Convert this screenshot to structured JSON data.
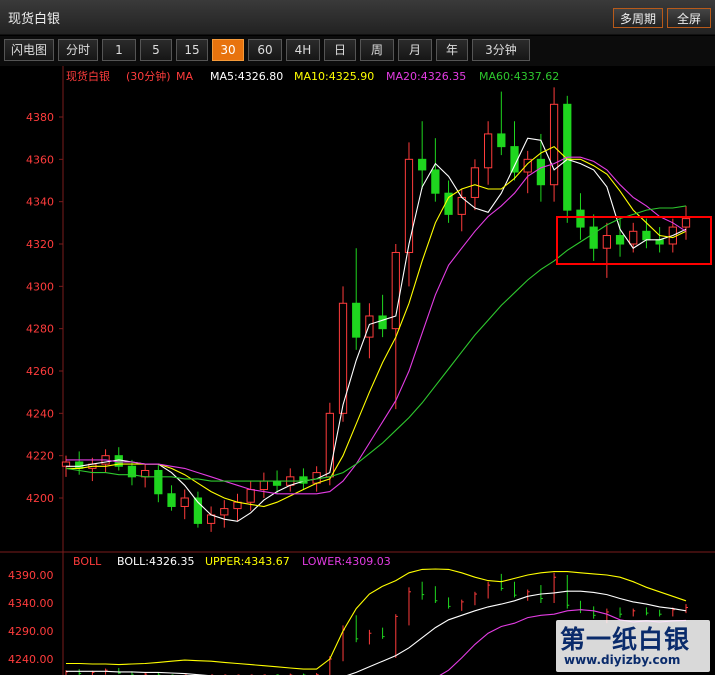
{
  "window": {
    "title": "现货白银",
    "buttons": [
      "多周期",
      "全屏"
    ]
  },
  "toolbar": {
    "periods": [
      "闪电图",
      "分时",
      "1",
      "5",
      "15",
      "30",
      "60",
      "4H",
      "日",
      "周",
      "月",
      "年",
      "3分钟"
    ],
    "active": "30"
  },
  "legend_main": {
    "symbol": "现货白银",
    "period": "(30分钟)",
    "indicator": "MA",
    "ma5": "MA5:4326.80",
    "ma10": "MA10:4325.90",
    "ma20": "MA20:4326.35",
    "ma60": "MA60:4337.62"
  },
  "legend_sub": {
    "indicator": "BOLL",
    "boll": "BOLL:4326.35",
    "upper": "UPPER:4343.67",
    "lower": "LOWER:4309.03"
  },
  "watermark": {
    "text": "第一纸白银",
    "url": "www.diyizby.com"
  },
  "colors": {
    "up": "#ff3c3c",
    "down": "#1fd61f",
    "ma5": "#ffffff",
    "ma10": "#ffff00",
    "ma20": "#e33ce3",
    "ma60": "#2ec82e",
    "axis_label_main": "#ff3c3c",
    "highlight_box": "#ff0000"
  },
  "chart_data": [
    {
      "type": "candlestick",
      "title": "现货白银 (30分钟) MA",
      "ylim": [
        4180,
        4400
      ],
      "y_ticks": [
        4200,
        4220,
        4240,
        4260,
        4280,
        4300,
        4320,
        4340,
        4360,
        4380
      ],
      "grid": false,
      "series": [
        {
          "name": "MA5",
          "values": [
            4215,
            4215,
            4216,
            4217,
            4218,
            4217,
            4216,
            4216,
            4212,
            4206,
            4198,
            4192,
            4190,
            4189,
            4193,
            4199,
            4203,
            4206,
            4208,
            4209,
            4212,
            4244,
            4265,
            4282,
            4284,
            4286,
            4320,
            4347,
            4358,
            4352,
            4342,
            4337,
            4335,
            4344,
            4357,
            4370,
            4369,
            4355,
            4360,
            4358,
            4355,
            4347,
            4327,
            4318,
            4322,
            4322,
            4324,
            4327
          ]
        },
        {
          "name": "MA10",
          "values": [
            4214,
            4214,
            4215,
            4215,
            4216,
            4216,
            4216,
            4216,
            4214,
            4211,
            4207,
            4203,
            4200,
            4198,
            4197,
            4196,
            4198,
            4201,
            4204,
            4207,
            4209,
            4220,
            4235,
            4250,
            4264,
            4276,
            4292,
            4312,
            4330,
            4342,
            4346,
            4348,
            4346,
            4346,
            4351,
            4358,
            4363,
            4366,
            4360,
            4360,
            4357,
            4353,
            4345,
            4336,
            4330,
            4324,
            4323,
            4326
          ]
        },
        {
          "name": "MA20",
          "values": [
            4218,
            4218,
            4218,
            4218,
            4217,
            4217,
            4216,
            4216,
            4215,
            4214,
            4212,
            4210,
            4208,
            4206,
            4204,
            4203,
            4202,
            4202,
            4202,
            4202,
            4203,
            4208,
            4216,
            4226,
            4236,
            4246,
            4260,
            4278,
            4296,
            4310,
            4318,
            4326,
            4333,
            4338,
            4344,
            4352,
            4356,
            4358,
            4361,
            4361,
            4359,
            4355,
            4348,
            4342,
            4338,
            4333,
            4330,
            4326
          ]
        },
        {
          "name": "MA60",
          "values": [
            4214,
            4213,
            4212,
            4212,
            4211,
            4211,
            4210,
            4210,
            4210,
            4209,
            4209,
            4208,
            4208,
            4208,
            4208,
            4208,
            4208,
            4208,
            4208,
            4209,
            4210,
            4212,
            4216,
            4221,
            4226,
            4232,
            4238,
            4245,
            4253,
            4261,
            4269,
            4277,
            4284,
            4291,
            4297,
            4303,
            4308,
            4312,
            4317,
            4321,
            4325,
            4329,
            4332,
            4334,
            4336,
            4337,
            4337,
            4338
          ]
        }
      ],
      "ohlc": [
        [
          4215,
          4220,
          4210,
          4217
        ],
        [
          4217,
          4222,
          4211,
          4214
        ],
        [
          4214,
          4219,
          4208,
          4216
        ],
        [
          4216,
          4223,
          4212,
          4220
        ],
        [
          4220,
          4224,
          4213,
          4215
        ],
        [
          4215,
          4218,
          4206,
          4210
        ],
        [
          4210,
          4216,
          4205,
          4213
        ],
        [
          4213,
          4216,
          4198,
          4202
        ],
        [
          4202,
          4206,
          4194,
          4196
        ],
        [
          4196,
          4204,
          4190,
          4200
        ],
        [
          4200,
          4203,
          4186,
          4188
        ],
        [
          4188,
          4196,
          4184,
          4192
        ],
        [
          4192,
          4199,
          4186,
          4195
        ],
        [
          4195,
          4202,
          4189,
          4198
        ],
        [
          4198,
          4208,
          4194,
          4204
        ],
        [
          4204,
          4212,
          4200,
          4208
        ],
        [
          4208,
          4213,
          4202,
          4206
        ],
        [
          4206,
          4214,
          4203,
          4210
        ],
        [
          4210,
          4214,
          4204,
          4207
        ],
        [
          4207,
          4215,
          4203,
          4212
        ],
        [
          4210,
          4245,
          4206,
          4240
        ],
        [
          4240,
          4300,
          4236,
          4292
        ],
        [
          4292,
          4318,
          4270,
          4276
        ],
        [
          4276,
          4292,
          4266,
          4286
        ],
        [
          4286,
          4296,
          4276,
          4280
        ],
        [
          4280,
          4320,
          4242,
          4316
        ],
        [
          4316,
          4368,
          4300,
          4360
        ],
        [
          4360,
          4378,
          4346,
          4355
        ],
        [
          4355,
          4370,
          4340,
          4344
        ],
        [
          4344,
          4350,
          4330,
          4334
        ],
        [
          4334,
          4346,
          4326,
          4342
        ],
        [
          4342,
          4360,
          4336,
          4356
        ],
        [
          4356,
          4378,
          4348,
          4372
        ],
        [
          4372,
          4392,
          4362,
          4366
        ],
        [
          4366,
          4378,
          4350,
          4354
        ],
        [
          4354,
          4364,
          4344,
          4360
        ],
        [
          4360,
          4372,
          4340,
          4348
        ],
        [
          4348,
          4394,
          4340,
          4386
        ],
        [
          4386,
          4390,
          4330,
          4336
        ],
        [
          4336,
          4344,
          4322,
          4328
        ],
        [
          4328,
          4334,
          4312,
          4318
        ],
        [
          4318,
          4330,
          4304,
          4324
        ],
        [
          4324,
          4332,
          4314,
          4320
        ],
        [
          4320,
          4330,
          4316,
          4326
        ],
        [
          4326,
          4332,
          4318,
          4322
        ],
        [
          4322,
          4328,
          4316,
          4320
        ],
        [
          4320,
          4332,
          4316,
          4328
        ],
        [
          4328,
          4338,
          4322,
          4332
        ]
      ]
    },
    {
      "type": "line",
      "title": "BOLL",
      "y_ticks": [
        4240.0,
        4290.0,
        4340.0,
        4390.0
      ],
      "y_tick_labels": [
        "4240.00",
        "4290.00",
        "4340.00",
        "4390.00"
      ],
      "series": [
        {
          "name": "BOLL",
          "values": [
            4218,
            4218,
            4218,
            4218,
            4217,
            4217,
            4216,
            4216,
            4215,
            4214,
            4212,
            4210,
            4208,
            4206,
            4204,
            4203,
            4202,
            4202,
            4202,
            4202,
            4203,
            4208,
            4216,
            4226,
            4236,
            4246,
            4260,
            4278,
            4296,
            4310,
            4318,
            4326,
            4333,
            4338,
            4344,
            4352,
            4356,
            4358,
            4361,
            4361,
            4359,
            4355,
            4348,
            4342,
            4338,
            4333,
            4330,
            4326
          ]
        },
        {
          "name": "UPPER",
          "values": [
            4232,
            4232,
            4231,
            4231,
            4230,
            4231,
            4232,
            4234,
            4236,
            4238,
            4237,
            4236,
            4234,
            4232,
            4230,
            4228,
            4226,
            4224,
            4222,
            4222,
            4240,
            4290,
            4330,
            4356,
            4370,
            4380,
            4394,
            4400,
            4402,
            4400,
            4394,
            4386,
            4380,
            4378,
            4384,
            4390,
            4394,
            4396,
            4396,
            4394,
            4392,
            4390,
            4386,
            4378,
            4368,
            4360,
            4352,
            4344
          ]
        },
        {
          "name": "LOWER",
          "values": [
            4204,
            4204,
            4205,
            4205,
            4204,
            4203,
            4200,
            4198,
            4194,
            4190,
            4187,
            4184,
            4182,
            4180,
            4178,
            4178,
            4178,
            4180,
            4182,
            4182,
            4166,
            4126,
            4102,
            4096,
            4102,
            4112,
            4126,
            4156,
            4190,
            4220,
            4242,
            4266,
            4286,
            4298,
            4304,
            4314,
            4318,
            4320,
            4326,
            4328,
            4326,
            4320,
            4310,
            4306,
            4308,
            4306,
            4308,
            4309
          ]
        }
      ],
      "ylim": [
        4210,
        4400
      ]
    }
  ]
}
